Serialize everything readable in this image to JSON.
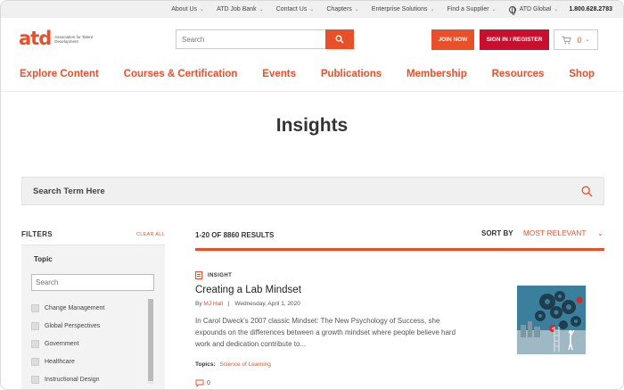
{
  "utility_nav": {
    "items": [
      "About Us",
      "ATD Job Bank",
      "Contact Us",
      "Chapters",
      "Enterprise Solutions",
      "Find a Supplier"
    ],
    "global_label": "ATD Global",
    "phone": "1.800.628.2783"
  },
  "header": {
    "logo_mark": "atd",
    "logo_text": "Association for Talent Development",
    "search_placeholder": "Search",
    "join_label": "JOIN NOW",
    "signin_label": "SIGN IN / REGISTER",
    "cart_count": "0"
  },
  "main_nav": [
    "Explore Content",
    "Courses & Certification",
    "Events",
    "Publications",
    "Membership",
    "Resources",
    "Shop"
  ],
  "page": {
    "title": "Insights",
    "search_label": "Search Term Here"
  },
  "filters": {
    "title": "FILTERS",
    "clear_all": "CLEAR ALL",
    "topic_title": "Topic",
    "topic_search_placeholder": "Search",
    "topics": [
      "Change Management",
      "Global Perspectives",
      "Government",
      "Healthcare",
      "Instructional Design"
    ]
  },
  "results": {
    "count_label": "1-20 OF 8860 RESULTS",
    "sort_label": "SORT BY",
    "sort_value": "MOST RELEVANT"
  },
  "card": {
    "type": "INSIGHT",
    "title": "Creating a Lab Mindset",
    "by": "By",
    "author": "MJ Hall",
    "date": "Wednesday, April 1, 2020",
    "description": "In Carol Dweck's 2007 classic Mindset: The New Psychology of Success, she expounds on the differences between a growth mindset where people believe hard work and dedication contribute to...",
    "topics_label": "Topics:",
    "topic_link": "Science of Learning",
    "comment_count": "0"
  },
  "colors": {
    "brand_orange": "#e8502a",
    "brand_red": "#c8102e"
  }
}
